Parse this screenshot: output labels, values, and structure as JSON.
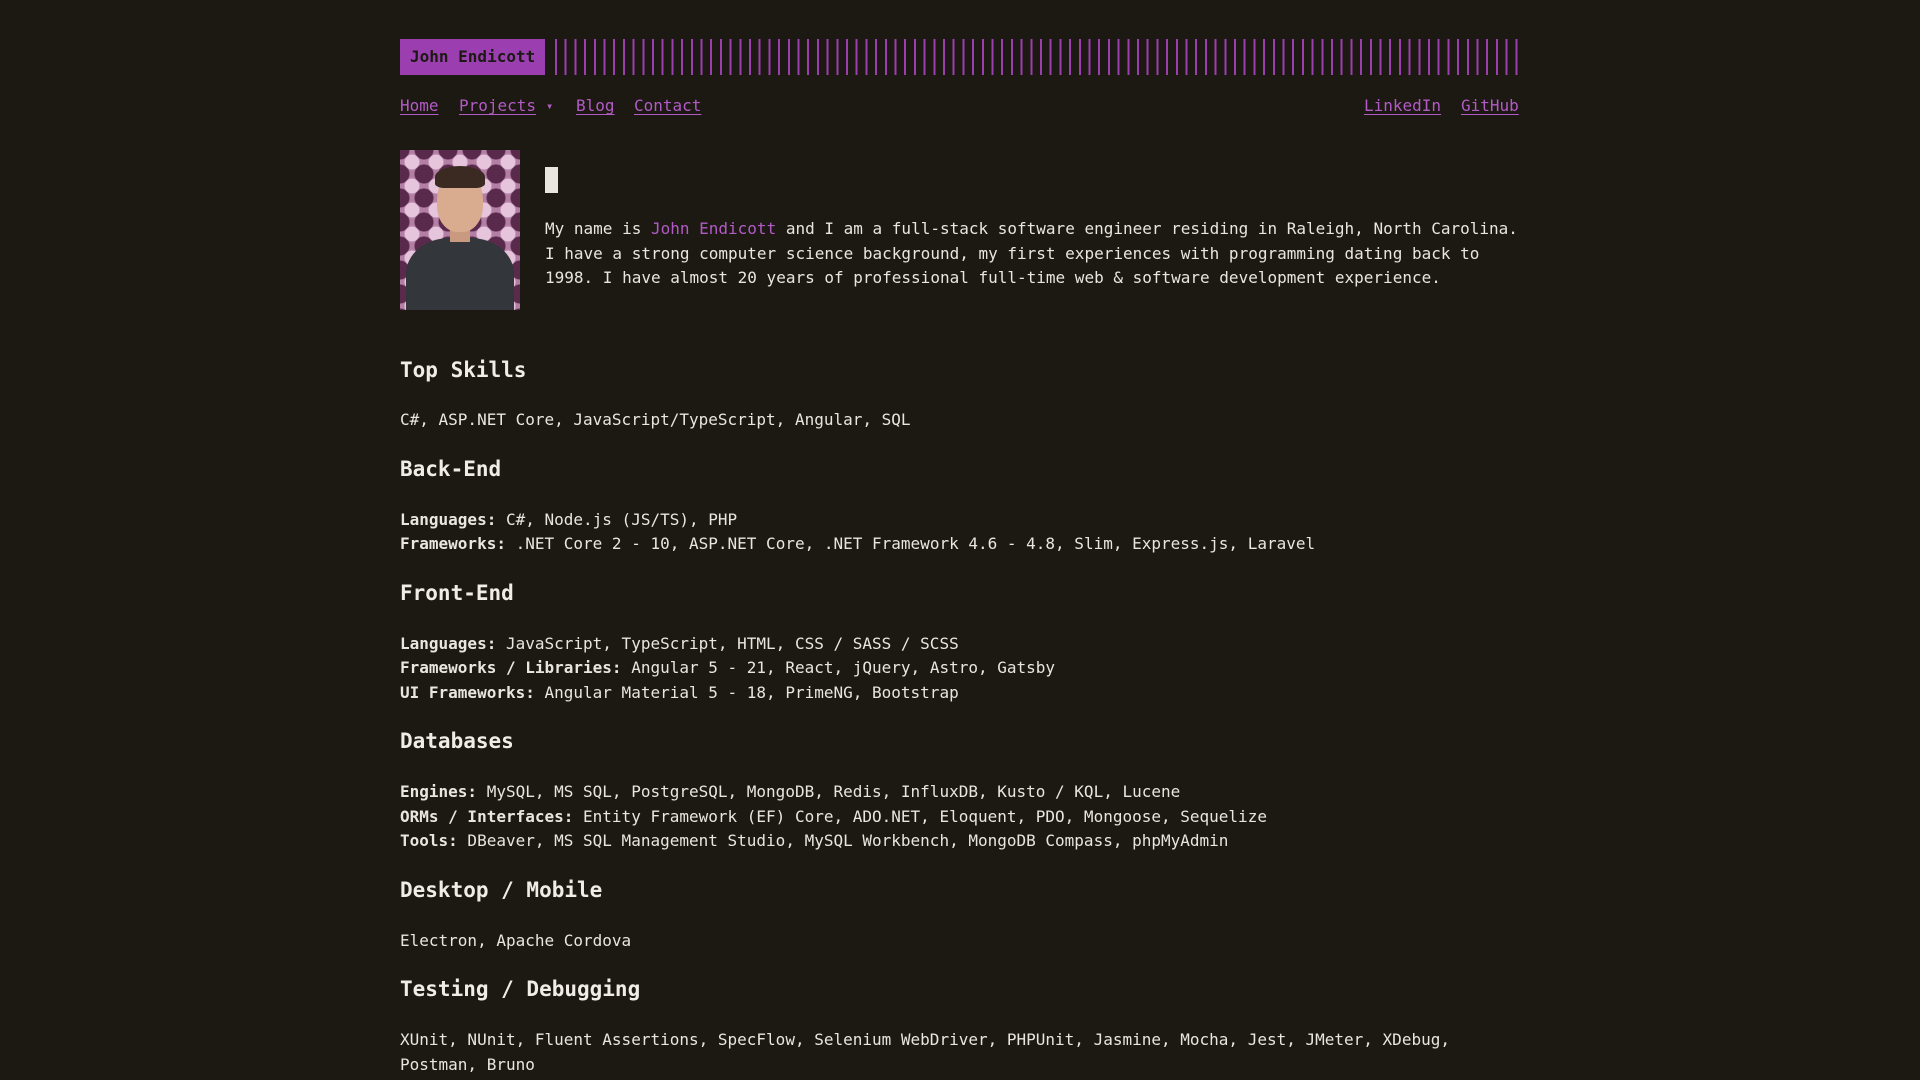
{
  "header": {
    "name": "John Endicott"
  },
  "nav": {
    "home": "Home",
    "projects": "Projects",
    "projects_arrow": "▾",
    "blog": "Blog",
    "contact": "Contact",
    "linkedin": "LinkedIn",
    "github": "GitHub"
  },
  "intro": {
    "before": "My name is ",
    "name": "John Endicott",
    "after": " and I am a full-stack software engineer residing in Raleigh, North Carolina. I have a strong computer science background, my first experiences with programming dating back to 1998. I have almost 20 years of professional full-time web & software development experience."
  },
  "top_skills": {
    "heading": "Top Skills",
    "text": "C#, ASP.NET Core, JavaScript/TypeScript, Angular, SQL"
  },
  "back_end": {
    "heading": "Back-End",
    "languages_label": "Languages:",
    "languages": " C#, Node.js (JS/TS), PHP",
    "frameworks_label": "Frameworks:",
    "frameworks": " .NET Core 2 - 10, ASP.NET Core, .NET Framework 4.6 - 4.8, Slim, Express.js, Laravel"
  },
  "front_end": {
    "heading": "Front-End",
    "languages_label": "Languages:",
    "languages": " JavaScript, TypeScript, HTML, CSS / SASS / SCSS",
    "frameworks_label": "Frameworks / Libraries:",
    "frameworks": " Angular 5 - 21, React, jQuery, Astro, Gatsby",
    "ui_label": "UI Frameworks:",
    "ui": " Angular Material 5 - 18, PrimeNG, Bootstrap"
  },
  "databases": {
    "heading": "Databases",
    "engines_label": "Engines:",
    "engines": " MySQL, MS SQL, PostgreSQL, MongoDB, Redis, InfluxDB, Kusto / KQL, Lucene",
    "orms_label": "ORMs / Interfaces:",
    "orms": " Entity Framework (EF) Core, ADO.NET, Eloquent, PDO, Mongoose, Sequelize",
    "tools_label": "Tools:",
    "tools": " DBeaver, MS SQL Management Studio, MySQL Workbench, MongoDB Compass, phpMyAdmin"
  },
  "desktop_mobile": {
    "heading": "Desktop / Mobile",
    "text": "Electron, Apache Cordova"
  },
  "testing": {
    "heading": "Testing / Debugging",
    "text": "XUnit, NUnit, Fluent Assertions, SpecFlow, Selenium WebDriver, PHPUnit, Jasmine, Mocha, Jest, JMeter, XDebug, Postman, Bruno"
  },
  "colors": {
    "background": "#1c1812",
    "accent": "#9b3fb0",
    "link": "#b25bc6",
    "text": "#e9e6df"
  }
}
